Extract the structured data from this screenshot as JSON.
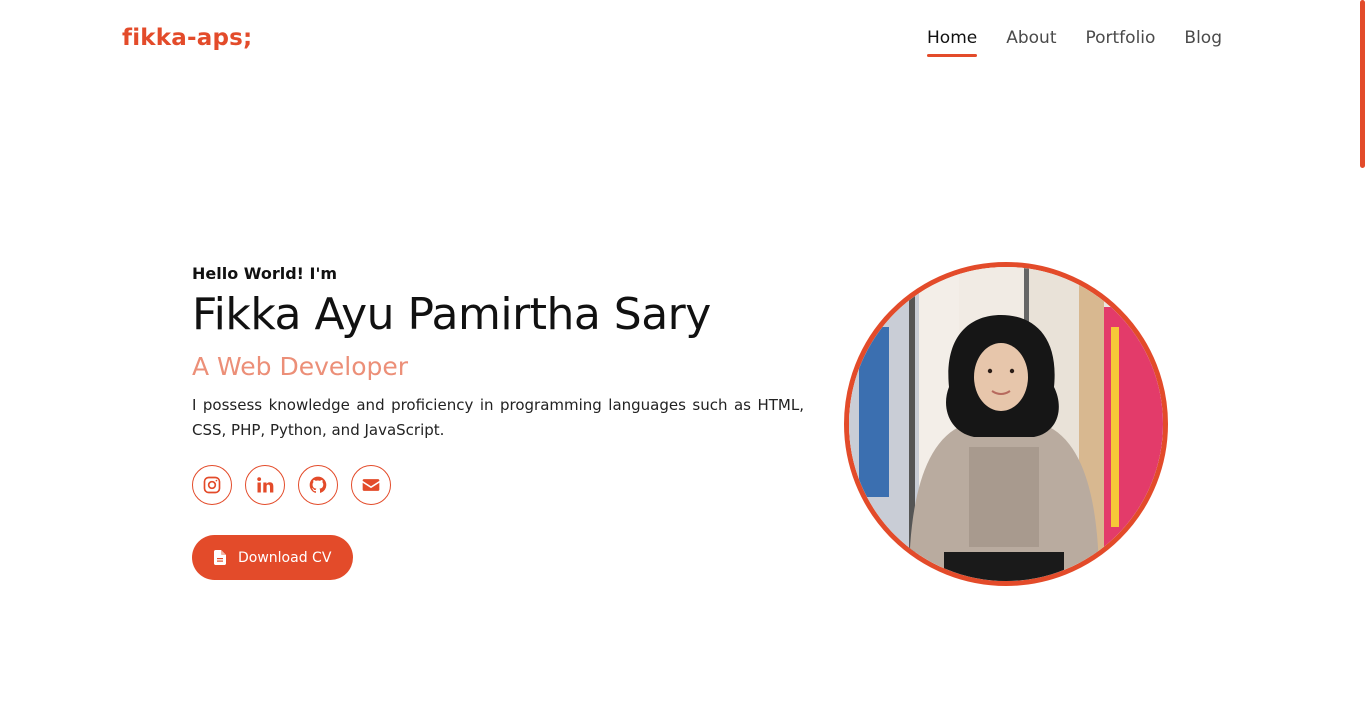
{
  "header": {
    "logo": "fikka-aps;",
    "nav": [
      {
        "label": "Home",
        "active": true
      },
      {
        "label": "About",
        "active": false
      },
      {
        "label": "Portfolio",
        "active": false
      },
      {
        "label": "Blog",
        "active": false
      }
    ]
  },
  "hero": {
    "greeting": "Hello World! I'm",
    "name": "Fikka Ayu Pamirtha Sary",
    "role": "A Web Developer",
    "description": "I possess knowledge and proficiency in programming languages such as HTML, CSS, PHP, Python, and JavaScript.",
    "socials": [
      {
        "icon": "instagram-icon"
      },
      {
        "icon": "linkedin-icon"
      },
      {
        "icon": "github-icon"
      },
      {
        "icon": "envelope-icon"
      }
    ],
    "download_label": "Download CV"
  },
  "colors": {
    "accent": "#e34b2a",
    "role_text": "#ec8f78"
  }
}
